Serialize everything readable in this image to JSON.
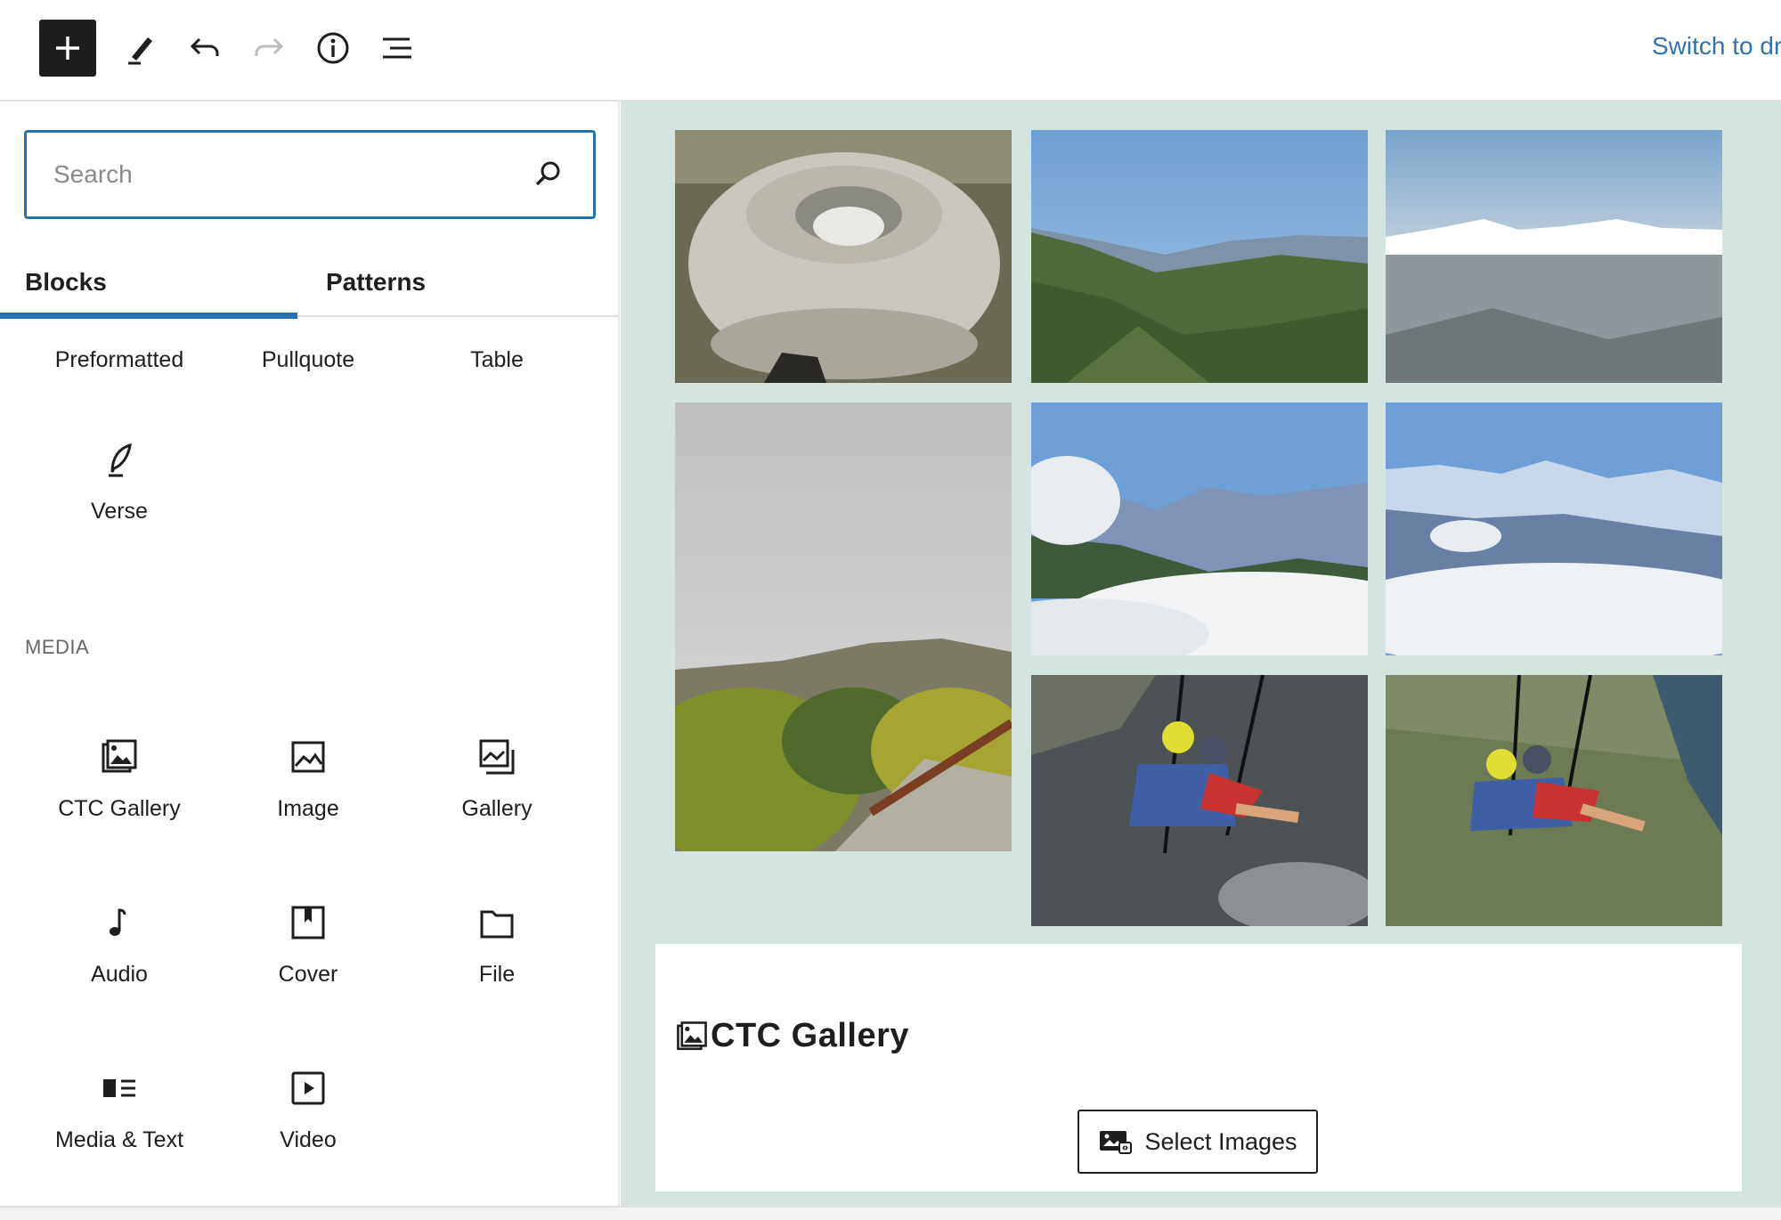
{
  "toolbar": {
    "inserter_label": "Add block",
    "switch_link": "Switch to draft"
  },
  "inserter": {
    "search_placeholder": "Search",
    "tabs": [
      {
        "label": "Blocks",
        "active": true
      },
      {
        "label": "Patterns",
        "active": false
      }
    ],
    "text_blocks": [
      {
        "label": "Preformatted"
      },
      {
        "label": "Pullquote"
      },
      {
        "label": "Table"
      },
      {
        "label": "Verse",
        "icon": "verse-icon"
      }
    ],
    "media_section_title": "MEDIA",
    "media_blocks": [
      {
        "label": "CTC Gallery",
        "icon": "ctc-gallery-icon"
      },
      {
        "label": "Image",
        "icon": "image-icon"
      },
      {
        "label": "Gallery",
        "icon": "gallery-icon"
      },
      {
        "label": "Audio",
        "icon": "audio-icon"
      },
      {
        "label": "Cover",
        "icon": "cover-icon"
      },
      {
        "label": "File",
        "icon": "file-icon"
      },
      {
        "label": "Media & Text",
        "icon": "media-text-icon"
      },
      {
        "label": "Video",
        "icon": "video-icon"
      }
    ]
  },
  "gallery_photos": [
    {
      "subject": "stone mill on rocks"
    },
    {
      "subject": "green valley and hills"
    },
    {
      "subject": "snow mountain range in haze"
    },
    {
      "subject": "misty garden on hilltop"
    },
    {
      "subject": "clouds over mountain valley"
    },
    {
      "subject": "snow peaks above clouds"
    },
    {
      "subject": "paragliders over lake"
    },
    {
      "subject": "paragliders over town"
    }
  ],
  "ctc_block": {
    "title": "CTC Gallery",
    "button_label": "Select Images"
  },
  "colors": {
    "accent": "#2271b1",
    "link": "#3073b0",
    "canvas_bg": "#d4e4de"
  }
}
